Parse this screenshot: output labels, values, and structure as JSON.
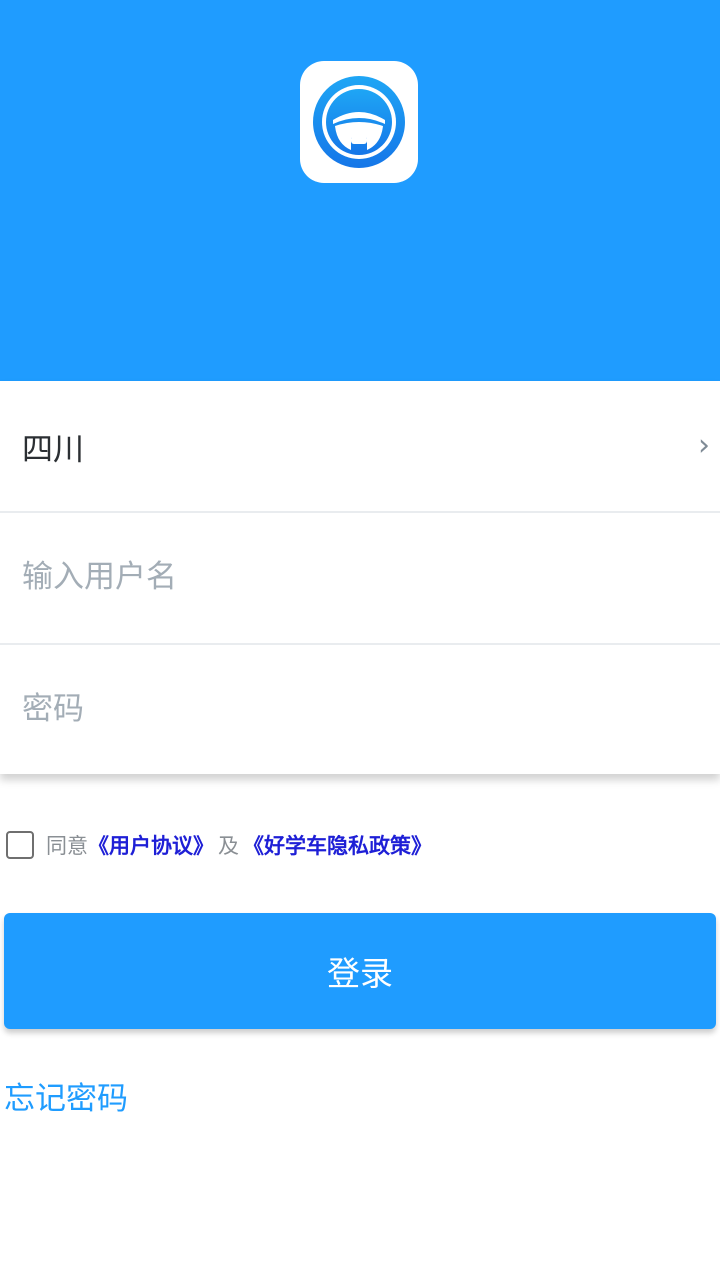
{
  "colors": {
    "primary": "#1f9cff",
    "link": "#1e1fd6"
  },
  "header": {
    "logo_icon": "steering-wheel-icon"
  },
  "form": {
    "region_value": "四川",
    "region_chevron": "›",
    "username_placeholder": "输入用户名",
    "password_placeholder": "密码"
  },
  "agreement": {
    "prefix": "同意",
    "user_agreement": "《用户协议》",
    "and": "及",
    "privacy_policy": "《好学车隐私政策》"
  },
  "login_label": "登录",
  "forgot_password": "忘记密码"
}
